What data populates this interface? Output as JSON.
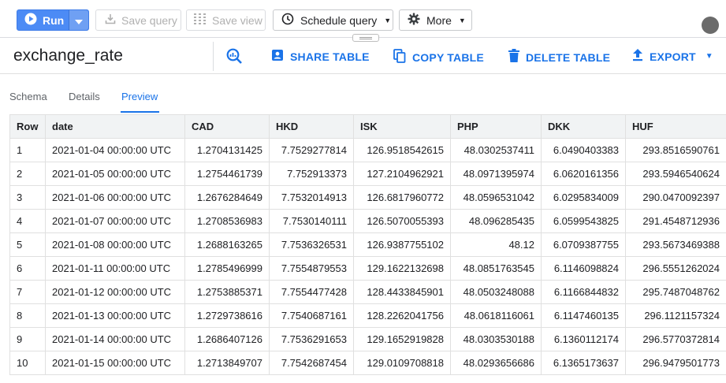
{
  "toolbar": {
    "run_label": "Run",
    "save_query_label": "Save query",
    "save_view_label": "Save view",
    "schedule_query_label": "Schedule query",
    "more_label": "More"
  },
  "table_bar": {
    "table_name": "exchange_rate",
    "share_label": "SHARE TABLE",
    "copy_label": "COPY TABLE",
    "delete_label": "DELETE TABLE",
    "export_label": "EXPORT"
  },
  "tabs": {
    "schema": "Schema",
    "details": "Details",
    "preview": "Preview",
    "active": "Preview"
  },
  "grid": {
    "columns": [
      "Row",
      "date",
      "CAD",
      "HKD",
      "ISK",
      "PHP",
      "DKK",
      "HUF"
    ],
    "rows": [
      [
        "1",
        "2021-01-04 00:00:00 UTC",
        "1.2704131425",
        "7.7529277814",
        "126.9518542615",
        "48.0302537411",
        "6.0490403383",
        "293.8516590761"
      ],
      [
        "2",
        "2021-01-05 00:00:00 UTC",
        "1.2754461739",
        "7.752913373",
        "127.2104962921",
        "48.0971395974",
        "6.0620161356",
        "293.5946540624"
      ],
      [
        "3",
        "2021-01-06 00:00:00 UTC",
        "1.2676284649",
        "7.7532014913",
        "126.6817960772",
        "48.0596531042",
        "6.0295834009",
        "290.0470092397"
      ],
      [
        "4",
        "2021-01-07 00:00:00 UTC",
        "1.2708536983",
        "7.7530140111",
        "126.5070055393",
        "48.096285435",
        "6.0599543825",
        "291.4548712936"
      ],
      [
        "5",
        "2021-01-08 00:00:00 UTC",
        "1.2688163265",
        "7.7536326531",
        "126.9387755102",
        "48.12",
        "6.0709387755",
        "293.5673469388"
      ],
      [
        "6",
        "2021-01-11 00:00:00 UTC",
        "1.2785496999",
        "7.7554879553",
        "129.1622132698",
        "48.0851763545",
        "6.1146098824",
        "296.5551262024"
      ],
      [
        "7",
        "2021-01-12 00:00:00 UTC",
        "1.2753885371",
        "7.7554477428",
        "128.4433845901",
        "48.0503248088",
        "6.1166844832",
        "295.7487048762"
      ],
      [
        "8",
        "2021-01-13 00:00:00 UTC",
        "1.2729738616",
        "7.7540687161",
        "128.2262041756",
        "48.0618116061",
        "6.1147460135",
        "296.1121157324"
      ],
      [
        "9",
        "2021-01-14 00:00:00 UTC",
        "1.2686407126",
        "7.7536291653",
        "129.1652919828",
        "48.0303530188",
        "6.1360112174",
        "296.5770372814"
      ],
      [
        "10",
        "2021-01-15 00:00:00 UTC",
        "1.2713849707",
        "7.7542687454",
        "129.0109708818",
        "48.0293656686",
        "6.1365173637",
        "296.9479501773"
      ]
    ]
  },
  "colors": {
    "accent": "#1a73e8",
    "run_button": "#4c8bf5",
    "header_bg": "#f1f3f4"
  }
}
